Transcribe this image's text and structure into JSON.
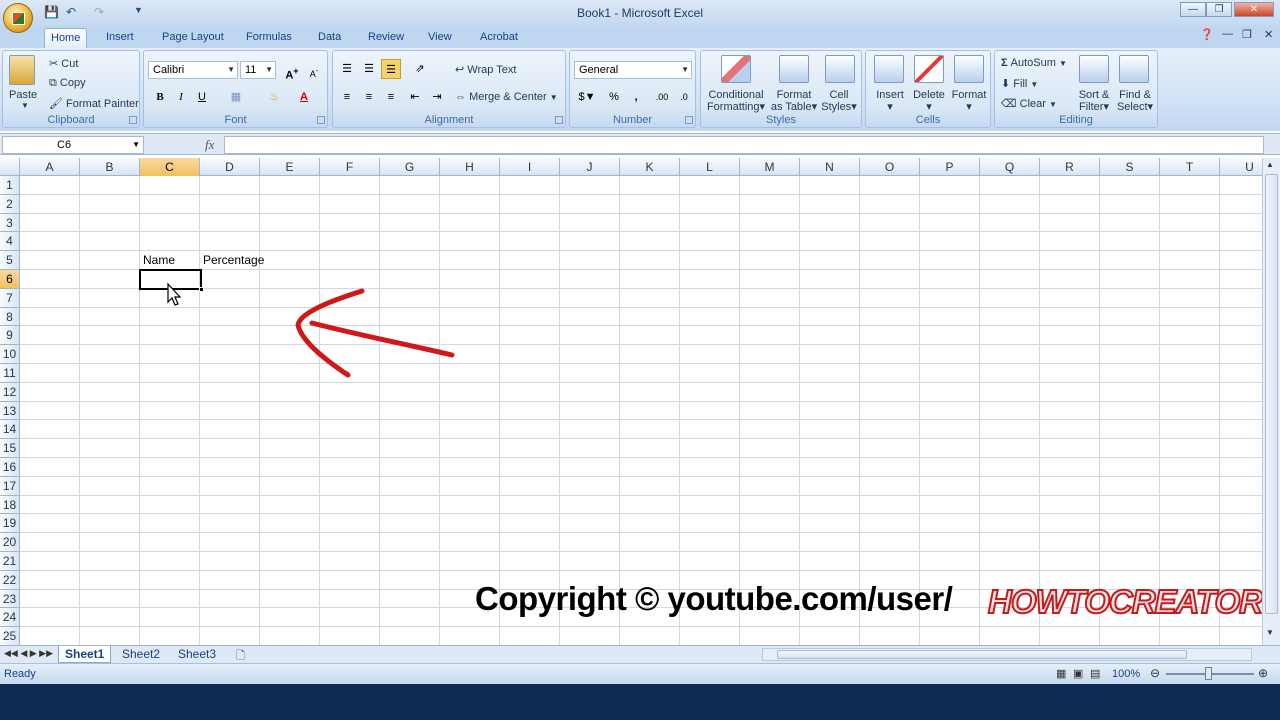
{
  "window": {
    "title": "Book1 - Microsoft Excel"
  },
  "tabs": [
    "Home",
    "Insert",
    "Page Layout",
    "Formulas",
    "Data",
    "Review",
    "View",
    "Acrobat"
  ],
  "clipboard": {
    "paste": "Paste",
    "cut": "Cut",
    "copy": "Copy",
    "format_painter": "Format Painter",
    "label": "Clipboard"
  },
  "font": {
    "name": "Calibri",
    "size": "11",
    "bold": "B",
    "italic": "I",
    "underline": "U",
    "label": "Font"
  },
  "alignment": {
    "wrap_text": "Wrap Text",
    "merge_center": "Merge & Center",
    "label": "Alignment"
  },
  "number": {
    "format": "General",
    "label": "Number"
  },
  "styles": {
    "conditional": "Conditional",
    "conditional2": "Formatting",
    "format_table": "Format",
    "format_table2": "as Table",
    "cell_styles": "Cell",
    "cell_styles2": "Styles",
    "label": "Styles"
  },
  "cells": {
    "insert": "Insert",
    "delete": "Delete",
    "format": "Format",
    "label": "Cells"
  },
  "editing": {
    "autosum": "AutoSum",
    "fill": "Fill",
    "clear": "Clear",
    "sort": "Sort &",
    "sort2": "Filter",
    "find": "Find &",
    "find2": "Select",
    "label": "Editing"
  },
  "formula_bar": {
    "name_box": "C6",
    "fx": "fx",
    "value": ""
  },
  "columns": [
    "A",
    "B",
    "C",
    "D",
    "E",
    "F",
    "G",
    "H",
    "I",
    "J",
    "K",
    "L",
    "M",
    "N",
    "O",
    "P",
    "Q",
    "R",
    "S",
    "T",
    "U"
  ],
  "rows": [
    "1",
    "2",
    "3",
    "4",
    "5",
    "6",
    "7",
    "8",
    "9",
    "10",
    "11",
    "12",
    "13",
    "14",
    "15",
    "16",
    "17",
    "18",
    "19",
    "20",
    "21",
    "22",
    "23",
    "24",
    "25"
  ],
  "cells_data": {
    "C5": "Name",
    "D5": "Percentage"
  },
  "sheets": [
    "Sheet1",
    "Sheet2",
    "Sheet3"
  ],
  "status": {
    "text": "Ready",
    "zoom": "100%"
  },
  "overlay": {
    "copyright": "Copyright © youtube.com/user/",
    "brand": "HOWTOCREATOR"
  },
  "colors": {
    "accent": "#15428b",
    "selection": "#f1c15f",
    "arrow": "#d01818"
  }
}
